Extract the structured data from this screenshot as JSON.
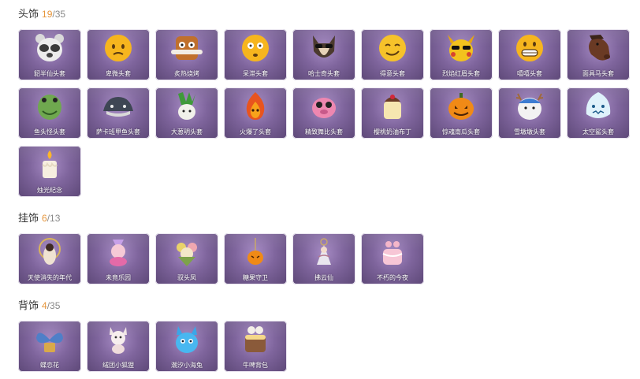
{
  "sections": [
    {
      "title": "头饰",
      "owned": "19",
      "total": "/35",
      "items": [
        {
          "name": "貂半仙头套",
          "icon": "raccoon-mask-icon"
        },
        {
          "name": "卑微头套",
          "icon": "humble-emoji-icon"
        },
        {
          "name": "炙热烧烤",
          "icon": "grilled-toast-icon"
        },
        {
          "name": "呆滞头套",
          "icon": "dazed-emoji-icon"
        },
        {
          "name": "哈士奇头套",
          "icon": "husky-sunglasses-icon"
        },
        {
          "name": "得意头套",
          "icon": "smug-emoji-icon"
        },
        {
          "name": "烈焰红眉头套",
          "icon": "red-brow-mascot-icon"
        },
        {
          "name": "嘻嘻头套",
          "icon": "grin-emoji-icon"
        },
        {
          "name": "面具马头套",
          "icon": "horse-head-icon"
        },
        {
          "name": "鱼头怪头套",
          "icon": "fish-monster-icon"
        },
        {
          "name": "萨卡班甲鱼头套",
          "icon": "armored-fish-icon"
        },
        {
          "name": "大葱明头套",
          "icon": "green-onion-icon"
        },
        {
          "name": "火爆了头套",
          "icon": "fire-spirit-icon"
        },
        {
          "name": "精致舞比头套",
          "icon": "pink-creature-icon"
        },
        {
          "name": "樱桃奶油布丁",
          "icon": "cream-pudding-icon"
        },
        {
          "name": "惊魂南瓜头套",
          "icon": "pumpkin-icon"
        },
        {
          "name": "雪墩墩头套",
          "icon": "snow-reindeer-icon"
        },
        {
          "name": "太空鲨头套",
          "icon": "space-shark-icon"
        },
        {
          "name": "烛光纪念",
          "icon": "candle-icon"
        }
      ]
    },
    {
      "title": "挂饰",
      "owned": "6",
      "total": "/13",
      "items": [
        {
          "name": "天使消失的年代",
          "icon": "angel-pendant-icon"
        },
        {
          "name": "未竟乐园",
          "icon": "paradise-doll-icon"
        },
        {
          "name": "驭头凤",
          "icon": "phoenix-bouquet-icon"
        },
        {
          "name": "糖果守卫",
          "icon": "candy-guard-icon"
        },
        {
          "name": "拂云仙",
          "icon": "cloud-fairy-icon"
        },
        {
          "name": "不朽的今夜",
          "icon": "pink-cake-icon"
        }
      ]
    },
    {
      "title": "背饰",
      "owned": "4",
      "total": "/35",
      "items": [
        {
          "name": "蝶恋花",
          "icon": "butterfly-flower-icon"
        },
        {
          "name": "绒团小狐狸",
          "icon": "plush-fox-icon"
        },
        {
          "name": "潮汐小海兔",
          "icon": "sea-bunny-icon"
        },
        {
          "name": "牛啤背包",
          "icon": "beer-backpack-icon"
        }
      ]
    }
  ]
}
